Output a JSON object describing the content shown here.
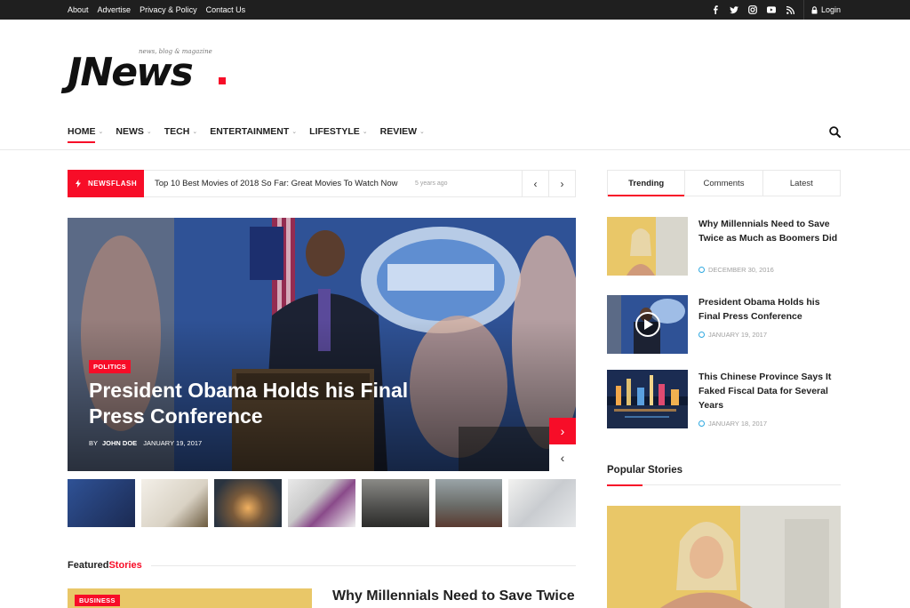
{
  "topbar": {
    "links": [
      "About",
      "Advertise",
      "Privacy & Policy",
      "Contact Us"
    ],
    "social_icons": [
      "facebook-icon",
      "twitter-icon",
      "instagram-icon",
      "youtube-icon",
      "rss-icon"
    ],
    "login_label": "Login"
  },
  "logo": {
    "tagline": "news, blog & magazine",
    "wordmark": "JNews"
  },
  "nav": {
    "items": [
      "HOME",
      "NEWS",
      "TECH",
      "ENTERTAINMENT",
      "LIFESTYLE",
      "REVIEW"
    ],
    "active": "HOME"
  },
  "newsflash": {
    "label": "NEWSFLASH",
    "headline": "Top 10 Best Movies of 2018 So Far: Great Movies To Watch Now",
    "ago": "5 years ago"
  },
  "hero": {
    "category": "POLITICS",
    "title": "President Obama Holds his Final Press Conference",
    "author_prefix": "BY",
    "author": "JOHN DOE",
    "date": "JANUARY 19, 2017"
  },
  "featured": {
    "heading_a": "Featured",
    "heading_b": "Stories",
    "category": "BUSINESS",
    "title": "Why Millennials Need to Save Twice"
  },
  "sidebar": {
    "tabs": [
      "Trending",
      "Comments",
      "Latest"
    ],
    "active_tab": "Trending",
    "trending": [
      {
        "title": "Why Millennials Need to Save Twice as Much as Boomers Did",
        "date": "DECEMBER 30, 2016"
      },
      {
        "title": "President Obama Holds his Final Press Conference",
        "date": "JANUARY 19, 2017"
      },
      {
        "title": "This Chinese Province Says It Faked Fiscal Data for Several Years",
        "date": "JANUARY 18, 2017"
      }
    ],
    "popular_heading": "Popular Stories"
  },
  "colors": {
    "accent": "#f70d28",
    "topbar": "#1f1f1f",
    "date_icon": "#2fa8e0"
  }
}
